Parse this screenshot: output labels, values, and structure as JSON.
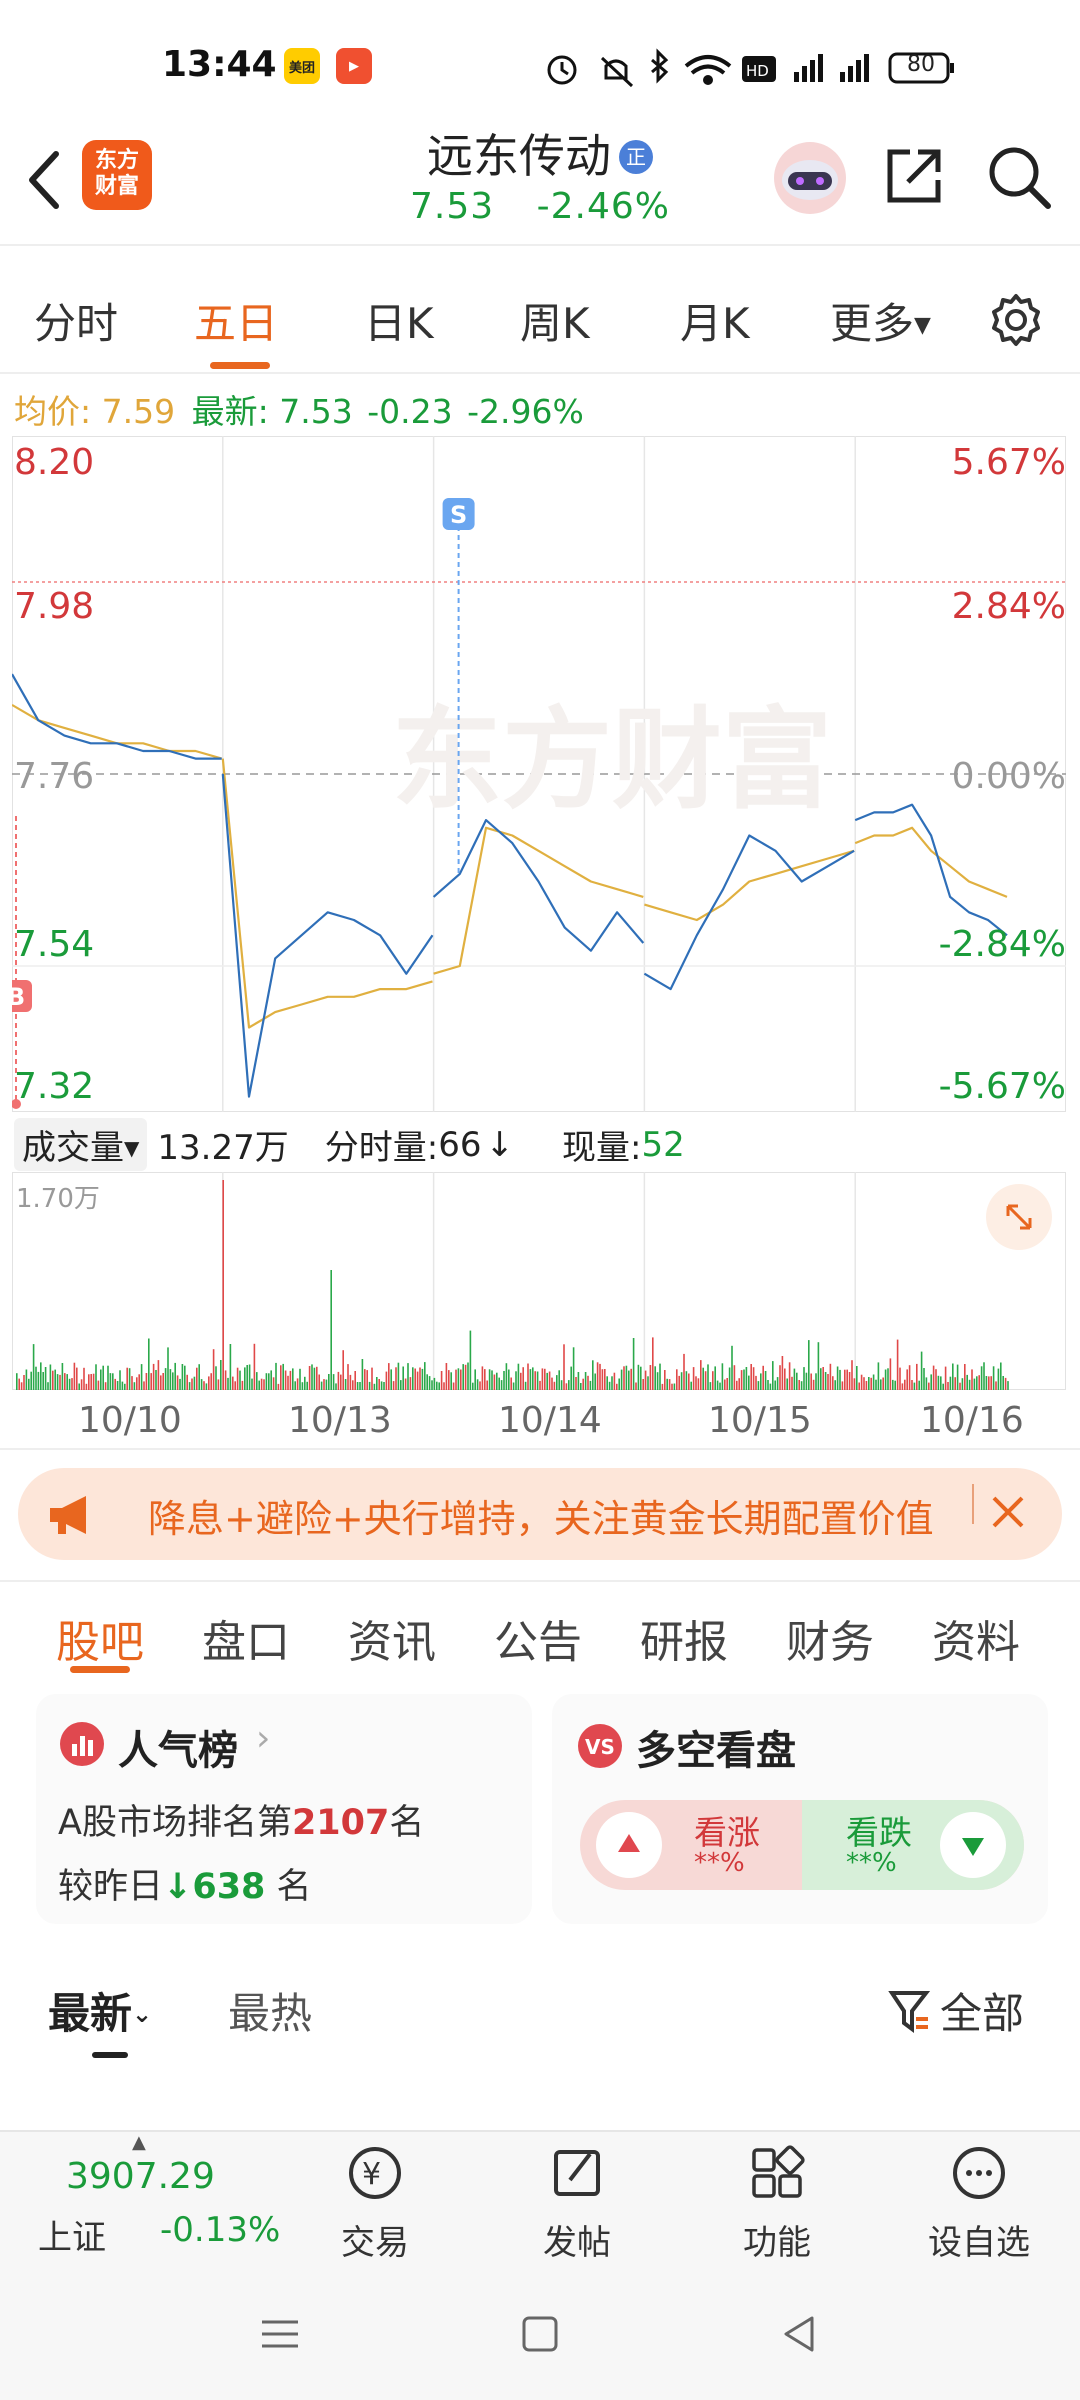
{
  "status_bar": {
    "time": "13:44",
    "battery": "80",
    "app_badges": [
      {
        "name": "meituan-badge",
        "label": "美团",
        "color": "#ffcc00"
      },
      {
        "name": "video-badge",
        "label": "▶",
        "color": "#f05030"
      }
    ]
  },
  "header": {
    "logo_text_1": "东方",
    "logo_text_2": "财富",
    "stock_name": "远东传动",
    "stock_tag": "正",
    "price": "7.53",
    "change_pct": "-2.46%"
  },
  "chart_tabs": [
    "分时",
    "五日",
    "日K",
    "周K",
    "月K",
    "更多"
  ],
  "active_chart_tab": "五日",
  "info_line": {
    "avg_label": "均价:",
    "avg_value": "7.59",
    "latest_label": "最新:",
    "latest_value": "7.53",
    "latest_change": "-0.23",
    "latest_pct": "-2.96%"
  },
  "chart_data": {
    "type": "line",
    "title": "",
    "watermark": "东方财富",
    "y_ticks_left": [
      "8.20",
      "7.98",
      "7.76",
      "7.54",
      "7.32"
    ],
    "y_ticks_right": [
      "5.67%",
      "2.84%",
      "0.00%",
      "-2.84%",
      "-5.67%"
    ],
    "ylim": [
      7.32,
      8.2
    ],
    "x_categories": [
      "10/10",
      "10/13",
      "10/14",
      "10/15",
      "10/16"
    ],
    "markers": [
      {
        "label": "B",
        "day": "10/10",
        "price": 7.34
      },
      {
        "label": "S",
        "day": "10/14",
        "price": 7.76
      }
    ],
    "series": [
      {
        "name": "最新",
        "color": "#2f6fb8",
        "values": [
          7.89,
          7.83,
          7.81,
          7.8,
          7.8,
          7.79,
          7.79,
          7.78,
          7.78,
          7.76,
          7.34,
          7.52,
          7.55,
          7.58,
          7.57,
          7.55,
          7.5,
          7.55,
          7.6,
          7.63,
          7.7,
          7.67,
          7.62,
          7.56,
          7.53,
          7.58,
          7.54,
          7.5,
          7.48,
          7.55,
          7.61,
          7.68,
          7.66,
          7.62,
          7.64,
          7.66,
          7.7,
          7.71,
          7.71,
          7.72,
          7.68,
          7.6,
          7.58,
          7.57,
          7.55
        ]
      },
      {
        "name": "均价",
        "color": "#e0b040",
        "values": [
          7.85,
          7.83,
          7.82,
          7.81,
          7.8,
          7.8,
          7.79,
          7.79,
          7.78,
          7.78,
          7.43,
          7.45,
          7.46,
          7.47,
          7.47,
          7.48,
          7.48,
          7.49,
          7.5,
          7.51,
          7.69,
          7.68,
          7.66,
          7.64,
          7.62,
          7.61,
          7.6,
          7.59,
          7.58,
          7.57,
          7.59,
          7.62,
          7.63,
          7.64,
          7.65,
          7.66,
          7.67,
          7.68,
          7.68,
          7.69,
          7.66,
          7.64,
          7.62,
          7.61,
          7.6
        ]
      }
    ]
  },
  "volume": {
    "dropdown_label": "成交量",
    "total": "13.27万",
    "minute_label": "分时量:",
    "minute_value": "66",
    "now_label": "现量:",
    "now_value": "52",
    "max_label": "1.70万"
  },
  "banner": {
    "text": "降息+避险+央行增持，关注黄金长期配置价值"
  },
  "section_tabs": [
    "股吧",
    "盘口",
    "资讯",
    "公告",
    "研报",
    "财务",
    "资料"
  ],
  "active_section_tab": "股吧",
  "popularity_card": {
    "title": "人气榜",
    "rank_prefix": "A股市场排名第",
    "rank_value": "2107",
    "rank_suffix": "名",
    "change_prefix": "较昨日",
    "change_value": "638",
    "change_suffix": "名"
  },
  "sentiment_card": {
    "title": "多空看盘",
    "bull_label": "看涨",
    "bull_value": "**%",
    "bear_label": "看跌",
    "bear_value": "**%"
  },
  "feed_tabs": {
    "latest": "最新",
    "hot": "最热",
    "filter": "全部"
  },
  "bottom_bar": {
    "index_value": "3907.29",
    "index_name": "上证",
    "index_change": "-0.13%",
    "items": [
      "交易",
      "发帖",
      "功能",
      "设自选"
    ]
  }
}
